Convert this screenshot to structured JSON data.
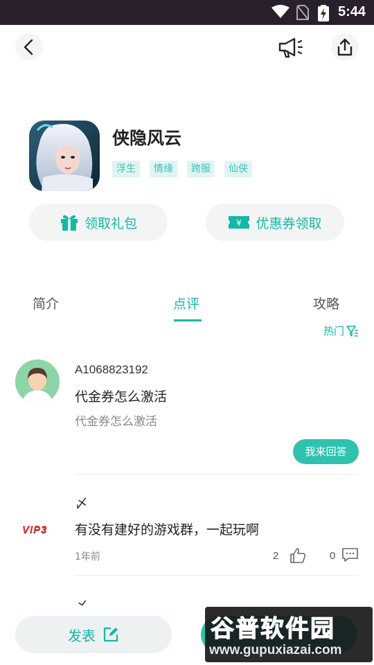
{
  "status_bar": {
    "time": "5:44"
  },
  "app": {
    "title": "侠隐风云",
    "tags": [
      "浮生",
      "情缘",
      "跨服",
      "仙侠"
    ]
  },
  "actions": {
    "gift_label": "领取礼包",
    "coupon_label": "优惠券领取"
  },
  "tabs": [
    {
      "label": "简介",
      "active": false
    },
    {
      "label": "点评",
      "active": true
    },
    {
      "label": "攻略",
      "active": false
    }
  ],
  "sort_label": "热门",
  "question": {
    "username": "A1068823192",
    "title": "代金券怎么激活",
    "body": "代金券怎么激活",
    "answer_button": "我来回答"
  },
  "post": {
    "badge": "VIP3",
    "username": "〆",
    "title": "有没有建好的游戏群，一起玩啊",
    "time": "1年前",
    "likes": "2",
    "comments": "0"
  },
  "next_post": {
    "username": "〆"
  },
  "bottom_bar": {
    "publish_label": "发表"
  },
  "watermark": {
    "main": "谷普软件园",
    "url": "www.gupuxiazai.com"
  },
  "colors": {
    "accent": "#13b8a6",
    "button_fill": "#2fc2ae",
    "status_bar": "#2a1f2c"
  }
}
